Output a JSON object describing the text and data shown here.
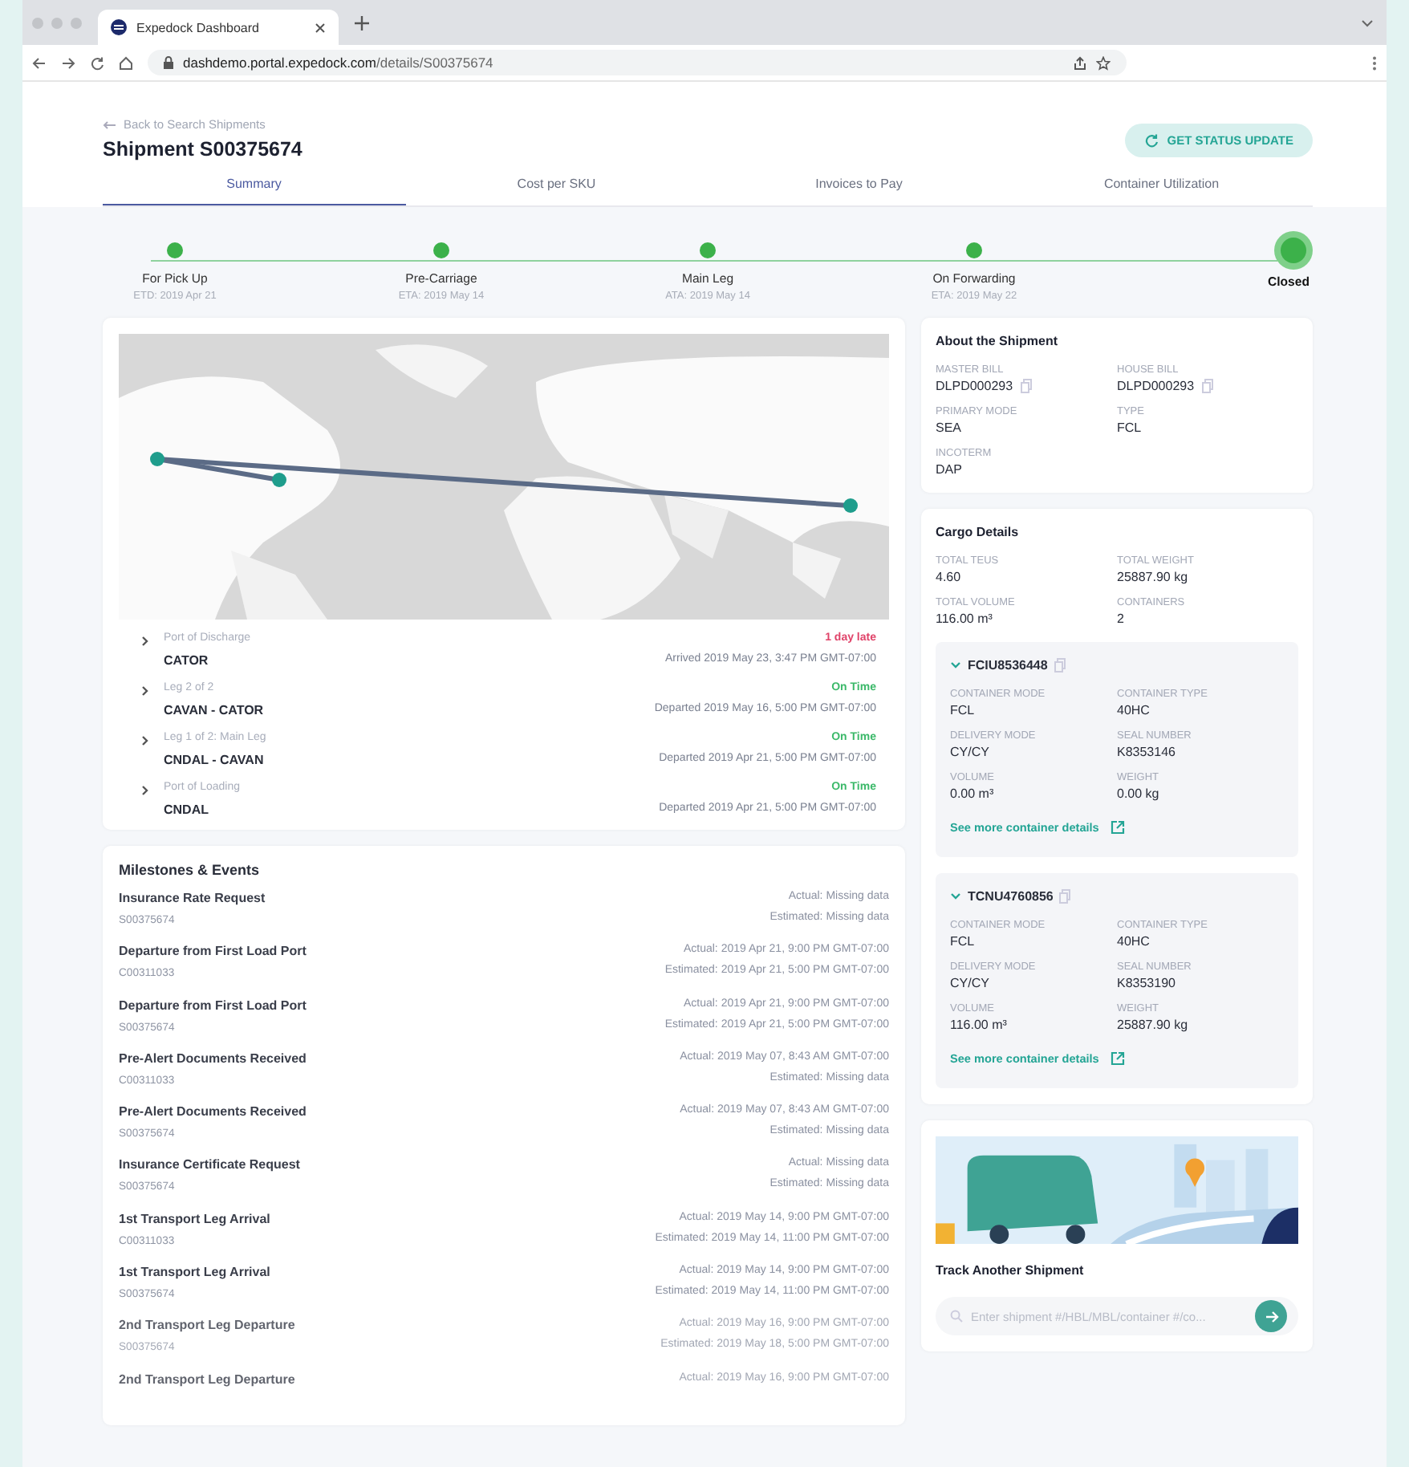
{
  "browser": {
    "tab_title": "Expedock Dashboard",
    "url_host": "dashdemo.portal.expedock.com",
    "url_path": "/details/S00375674"
  },
  "header": {
    "back_link": "Back to Search Shipments",
    "title": "Shipment S00375674",
    "status_button": "GET STATUS UPDATE"
  },
  "tabs": [
    {
      "label": "Summary",
      "selected": true
    },
    {
      "label": "Cost per SKU",
      "selected": false
    },
    {
      "label": "Invoices to Pay",
      "selected": false
    },
    {
      "label": "Container Utilization",
      "selected": false
    }
  ],
  "steps": [
    {
      "label": "For Pick Up",
      "date": "ETD: 2019 Apr 21",
      "current": false
    },
    {
      "label": "Pre-Carriage",
      "date": "ETA: 2019 May 14",
      "current": false
    },
    {
      "label": "Main Leg",
      "date": "ATA: 2019 May 14",
      "current": false
    },
    {
      "label": "On Forwarding",
      "date": "ETA: 2019 May 22",
      "current": false
    },
    {
      "label": "Closed",
      "current": true
    }
  ],
  "legs": [
    {
      "label": "Port of Discharge",
      "name": "CATOR",
      "status": "1 day late",
      "kind": "late",
      "detail": "Arrived 2019 May 23, 3:47 PM GMT-07:00"
    },
    {
      "label": "Leg 2 of 2",
      "name": "CAVAN - CATOR",
      "status": "On Time",
      "kind": "on_time",
      "detail": "Departed 2019 May 16, 5:00 PM GMT-07:00"
    },
    {
      "label": "Leg 1 of 2: Main Leg",
      "name": "CNDAL - CAVAN",
      "status": "On Time",
      "kind": "on_time",
      "detail": "Departed 2019 Apr 21, 5:00 PM GMT-07:00"
    },
    {
      "label": "Port of Loading",
      "name": "CNDAL",
      "status": "On Time",
      "kind": "on_time",
      "detail": "Departed 2019 Apr 21, 5:00 PM GMT-07:00"
    }
  ],
  "milestones": {
    "title": "Milestones & Events",
    "items": [
      {
        "name": "Insurance Rate Request",
        "ref": "S00375674",
        "actual": "Actual: Missing data",
        "estimated": "Estimated: Missing data"
      },
      {
        "name": "Departure from First Load Port",
        "ref": "C00311033",
        "actual": "Actual: 2019 Apr 21, 9:00 PM GMT-07:00",
        "estimated": "Estimated: 2019 Apr 21, 5:00 PM GMT-07:00"
      },
      {
        "name": "Departure from First Load Port",
        "ref": "S00375674",
        "actual": "Actual: 2019 Apr 21, 9:00 PM GMT-07:00",
        "estimated": "Estimated: 2019 Apr 21, 5:00 PM GMT-07:00"
      },
      {
        "name": "Pre-Alert Documents Received",
        "ref": "C00311033",
        "actual": "Actual: 2019 May 07, 8:43 AM GMT-07:00",
        "estimated": "Estimated: Missing data"
      },
      {
        "name": "Pre-Alert Documents Received",
        "ref": "S00375674",
        "actual": "Actual: 2019 May 07, 8:43 AM GMT-07:00",
        "estimated": "Estimated: Missing data"
      },
      {
        "name": "Insurance Certificate Request",
        "ref": "S00375674",
        "actual": "Actual: Missing data",
        "estimated": "Estimated: Missing data"
      },
      {
        "name": "1st Transport Leg Arrival",
        "ref": "C00311033",
        "actual": "Actual: 2019 May 14, 9:00 PM GMT-07:00",
        "estimated": "Estimated: 2019 May 14, 11:00 PM GMT-07:00"
      },
      {
        "name": "1st Transport Leg Arrival",
        "ref": "S00375674",
        "actual": "Actual: 2019 May 14, 9:00 PM GMT-07:00",
        "estimated": "Estimated: 2019 May 14, 11:00 PM GMT-07:00"
      },
      {
        "name": "2nd Transport Leg Departure",
        "ref": "S00375674",
        "actual": "Actual: 2019 May 16, 9:00 PM GMT-07:00",
        "estimated": "Estimated: 2019 May 18, 5:00 PM GMT-07:00"
      },
      {
        "name": "2nd Transport Leg Departure",
        "actual": "Actual: 2019 May 16, 9:00 PM GMT-07:00"
      }
    ]
  },
  "about": {
    "title": "About the Shipment",
    "fields": [
      {
        "label": "MASTER BILL",
        "value": "DLPD000293",
        "copyable": true
      },
      {
        "label": "HOUSE BILL",
        "value": "DLPD000293",
        "copyable": true
      },
      {
        "label": "PRIMARY MODE",
        "value": "SEA",
        "copyable": false
      },
      {
        "label": "TYPE",
        "value": "FCL",
        "copyable": false
      },
      {
        "label": "INCOTERM",
        "value": "DAP",
        "copyable": false
      }
    ]
  },
  "cargo": {
    "title": "Cargo Details",
    "fields": [
      {
        "label": "TOTAL TEUS",
        "value": "4.60"
      },
      {
        "label": "TOTAL WEIGHT",
        "value": "25887.90 kg"
      },
      {
        "label": "TOTAL VOLUME",
        "value": "116.00 m³"
      },
      {
        "label": "CONTAINERS",
        "value": "2"
      }
    ],
    "containers": [
      {
        "number": "FCIU8536448",
        "expanded": true,
        "link": "See more container details",
        "fields": [
          {
            "label": "CONTAINER MODE",
            "value": "FCL"
          },
          {
            "label": "CONTAINER TYPE",
            "value": "40HC"
          },
          {
            "label": "DELIVERY MODE",
            "value": "CY/CY"
          },
          {
            "label": "SEAL NUMBER",
            "value": "K8353146"
          },
          {
            "label": "VOLUME",
            "value": "0.00 m³"
          },
          {
            "label": "WEIGHT",
            "value": "0.00 kg"
          }
        ]
      },
      {
        "number": "TCNU4760856",
        "expanded": true,
        "link": "See more container details",
        "fields": [
          {
            "label": "CONTAINER MODE",
            "value": "FCL"
          },
          {
            "label": "CONTAINER TYPE",
            "value": "40HC"
          },
          {
            "label": "DELIVERY MODE",
            "value": "CY/CY"
          },
          {
            "label": "SEAL NUMBER",
            "value": "K8353190"
          },
          {
            "label": "VOLUME",
            "value": "116.00 m³"
          },
          {
            "label": "WEIGHT",
            "value": "25887.90 kg"
          }
        ]
      }
    ]
  },
  "track": {
    "title": "Track Another Shipment",
    "placeholder": "Enter shipment #/HBL/MBL/container #/co..."
  }
}
